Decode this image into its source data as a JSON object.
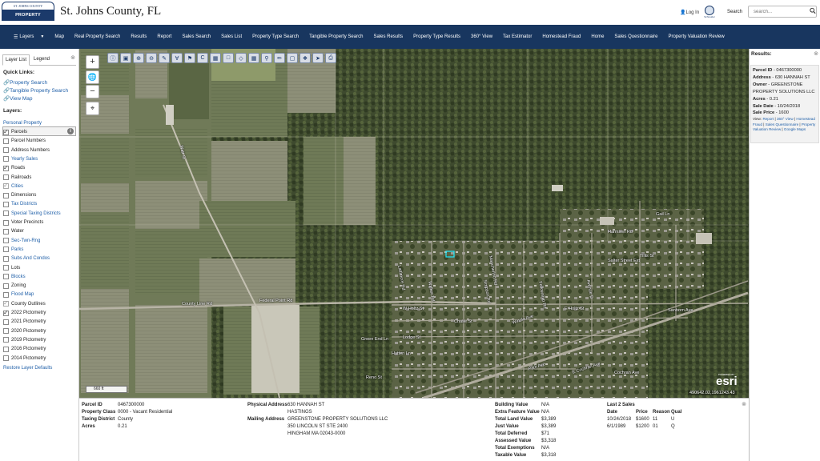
{
  "header": {
    "logo_top": "ST. JOHNS COUNTY",
    "logo_bottom": "PROPERTY APPRAISER",
    "title": "St. Johns County, FL",
    "login": "Log In",
    "seal_label": "Schneider",
    "search_label": "Search",
    "search_placeholder": "search..."
  },
  "nav": {
    "layers": "Layers",
    "items": [
      "Map",
      "Real Property Search",
      "Results",
      "Report",
      "Sales Search",
      "Sales List",
      "Property Type Search",
      "Tangible Property Search",
      "Sales Results",
      "Property Type Results",
      "360° View",
      "Tax Estimator",
      "Homestead Fraud",
      "Home",
      "Sales Questionnaire",
      "Property Valuation Review"
    ]
  },
  "left_panel": {
    "tabs": [
      "Layer List",
      "Legend"
    ],
    "quick_links_heading": "Quick Links:",
    "quick_links": [
      "Property Search",
      "Tangible Property Search",
      "View Map"
    ],
    "layers_heading": "Layers:",
    "personal_property": "Personal Property",
    "layers": [
      {
        "label": "Parcels",
        "checked": true,
        "link": false,
        "dim": false
      },
      {
        "label": "Parcel Numbers",
        "checked": false,
        "link": false,
        "dim": false
      },
      {
        "label": "Address Numbers",
        "checked": false,
        "link": false,
        "dim": false
      },
      {
        "label": "Yearly Sales",
        "checked": false,
        "link": true,
        "dim": false
      },
      {
        "label": "Roads",
        "checked": true,
        "link": false,
        "dim": false
      },
      {
        "label": "Railroads",
        "checked": false,
        "link": false,
        "dim": false
      },
      {
        "label": "Cities",
        "checked": true,
        "link": true,
        "dim": true
      },
      {
        "label": "Dimensions",
        "checked": false,
        "link": false,
        "dim": false
      },
      {
        "label": "Tax Districts",
        "checked": false,
        "link": true,
        "dim": false
      },
      {
        "label": "Special Taxing Districts",
        "checked": false,
        "link": true,
        "dim": false
      },
      {
        "label": "Voter Precincts",
        "checked": false,
        "link": false,
        "dim": false
      },
      {
        "label": "Water",
        "checked": false,
        "link": false,
        "dim": false
      },
      {
        "label": "Sec-Twn-Rng",
        "checked": false,
        "link": true,
        "dim": false
      },
      {
        "label": "Parks",
        "checked": false,
        "link": true,
        "dim": false
      },
      {
        "label": "Subs And Condos",
        "checked": false,
        "link": true,
        "dim": false
      },
      {
        "label": "Lots",
        "checked": false,
        "link": false,
        "dim": false
      },
      {
        "label": "Blocks",
        "checked": false,
        "link": true,
        "dim": false
      },
      {
        "label": "Zoning",
        "checked": false,
        "link": false,
        "dim": false
      },
      {
        "label": "Flood Map",
        "checked": false,
        "link": true,
        "dim": false
      },
      {
        "label": "County Outlines",
        "checked": true,
        "link": false,
        "dim": true
      },
      {
        "label": "2022 Pictometry",
        "checked": true,
        "link": false,
        "dim": false
      },
      {
        "label": "2021 Pictometry",
        "checked": false,
        "link": false,
        "dim": false
      },
      {
        "label": "2020 Pictometry",
        "checked": false,
        "link": false,
        "dim": false
      },
      {
        "label": "2019 Pictometry",
        "checked": false,
        "link": false,
        "dim": false
      },
      {
        "label": "2016 Pictometry",
        "checked": false,
        "link": false,
        "dim": false
      },
      {
        "label": "2014 Pictometry",
        "checked": false,
        "link": false,
        "dim": false
      }
    ],
    "restore": "Restore Layer Defaults"
  },
  "map": {
    "scale_label": "660 ft",
    "coords": "490642.02,1961243.43",
    "esri_text": "esri",
    "esri_powered": "POWERED BY",
    "street_labels": [
      "Federal Point Rd",
      "County Line Rd",
      "W Holtz St",
      "E Holtz St",
      "Chase St",
      "Green End Ln",
      "Lodge St",
      "Hatten Ln",
      "Reno St",
      "Park Ave",
      "E Cochran Ave",
      "Cochran Ave",
      "Salter Street Ext",
      "Harmsen Rd",
      "Tillis St",
      "Sanborn Ave",
      "Winola Ave",
      "Watt St",
      "Lattimore Rd",
      "Walker Rd",
      "Simpson Rd",
      "Fellowship Rd",
      "Avenue D",
      "Mancherino Rd",
      "Gail Ln"
    ]
  },
  "results": {
    "heading": "Results:",
    "parcel_id_label": "Parcel ID",
    "parcel_id": "0467300000",
    "address_label": "Address",
    "address": "630 HANNAH ST",
    "owner_label": "Owner",
    "owner": "GREENSTONE PROPERTY SOLUTIONS LLC",
    "acres_label": "Acres",
    "acres": "0.21",
    "sale_date_label": "Sale Date",
    "sale_date": "10/24/2018",
    "sale_price_label": "Sale Price",
    "sale_price": "1600",
    "view_label": "View:",
    "links": [
      "Report",
      "360° View",
      "Homestead Fraud",
      "Sales Questionnaire",
      "Property Valuation Review",
      "Google Maps"
    ]
  },
  "bottom": {
    "left": [
      {
        "k": "Parcel ID",
        "v": "0467300000"
      },
      {
        "k": "Property Class",
        "v": "0000 - Vacant Residential"
      },
      {
        "k": "Taxing District",
        "v": "County"
      },
      {
        "k": "Acres",
        "v": "0.21"
      }
    ],
    "physical_label": "Physical Address",
    "physical": [
      "630 HANNAH ST",
      "HASTINGS"
    ],
    "mailing_label": "Mailing Address",
    "mailing": [
      "GREENSTONE PROPERTY SOLUTIONS LLC",
      "350 LINCOLN ST STE 2400",
      "HINGHAM MA 02043-0000"
    ],
    "values": [
      {
        "k": "Building Value",
        "v": "N/A"
      },
      {
        "k": "Extra Feature Value",
        "v": "N/A"
      },
      {
        "k": "Total Land Value",
        "v": "$3,389"
      },
      {
        "k": "Just Value",
        "v": "$3,389"
      },
      {
        "k": "Total Deferred",
        "v": "$71"
      },
      {
        "k": "Assessed Value",
        "v": "$3,318"
      },
      {
        "k": "Total Exemptions",
        "v": "N/A"
      },
      {
        "k": "Taxable Value",
        "v": "$3,318"
      }
    ],
    "sales_heading": "Last 2 Sales",
    "sales_columns": [
      "Date",
      "Price",
      "Reason",
      "Qual"
    ],
    "sales_rows": [
      [
        "10/24/2018",
        "$1600",
        "11",
        "U"
      ],
      [
        "6/1/1989",
        "$1200",
        "01",
        "Q"
      ]
    ]
  }
}
